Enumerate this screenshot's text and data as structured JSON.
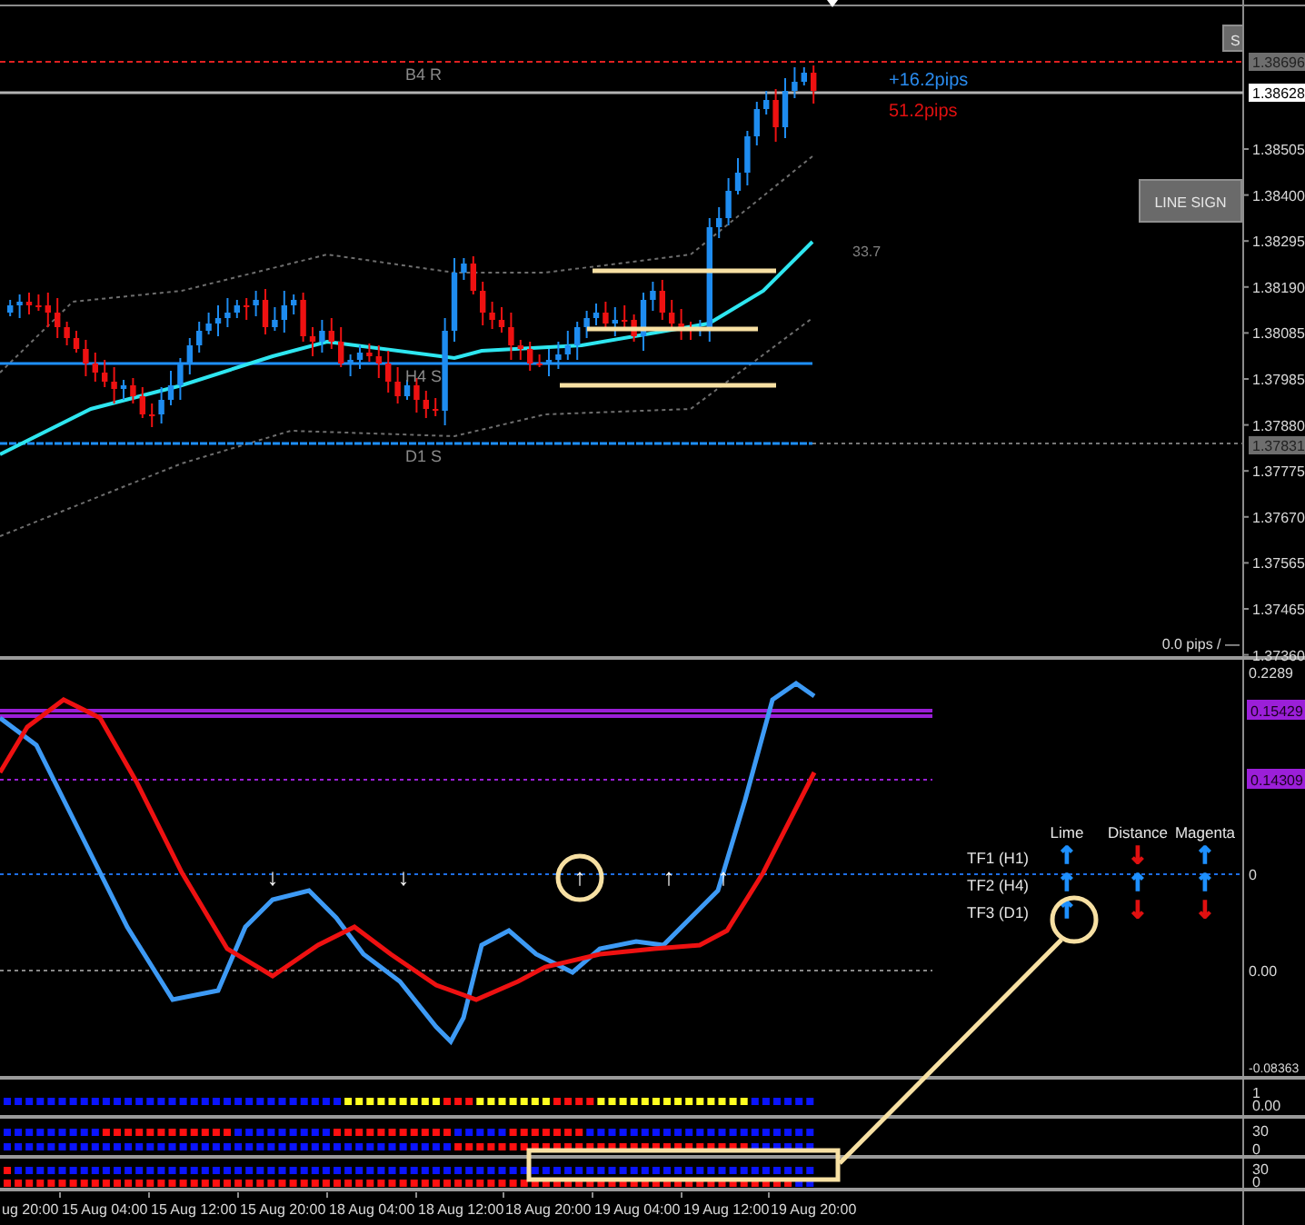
{
  "price_chart": {
    "partial_button": "S",
    "level_labels": [
      "B4 R",
      "H4 S",
      "D1 S"
    ],
    "pips_gain": "+16.2pips",
    "pips_range": "51.2pips",
    "value_label": "33.7",
    "line_sign_button": "LINE SIGN",
    "status_text": "0.0 pips / —",
    "price_axis": [
      "1.38505",
      "1.38400",
      "1.38295",
      "1.38190",
      "1.38085",
      "1.37985",
      "1.37880",
      "1.37775",
      "1.37670",
      "1.37565",
      "1.37465",
      "1.37360"
    ],
    "price_tags": [
      {
        "text": "1.38696",
        "kind": "gray"
      },
      {
        "text": "1.38628",
        "kind": "white"
      },
      {
        "text": "1.37831",
        "kind": "gray"
      }
    ]
  },
  "oscillator": {
    "axis_labels": [
      "0.2289",
      "0",
      "0.00",
      "-0.08363"
    ],
    "value_tags": [
      "0.15429",
      "0.14309"
    ],
    "signals": [
      {
        "arrow": "↓"
      },
      {
        "arrow": "↓"
      },
      {
        "arrow": "↑"
      },
      {
        "arrow": "↑"
      },
      {
        "arrow": "↑"
      }
    ],
    "table": {
      "columns": [
        "Lime",
        "Distance",
        "Magenta"
      ],
      "rows": [
        {
          "label": "TF1 (H1)",
          "cells": [
            {
              "arrow": "↑",
              "color": "#1e90ff"
            },
            {
              "arrow": "↓",
              "color": "#e01010"
            },
            {
              "arrow": "↑",
              "color": "#1e90ff"
            }
          ]
        },
        {
          "label": "TF2 (H4)",
          "cells": [
            {
              "arrow": "↑",
              "color": "#1e90ff"
            },
            {
              "arrow": "↑",
              "color": "#1e90ff"
            },
            {
              "arrow": "↑",
              "color": "#1e90ff"
            }
          ]
        },
        {
          "label": "TF3 (D1)",
          "cells": [
            {
              "arrow": "↑",
              "color": "#1e90ff"
            },
            {
              "arrow": "↓",
              "color": "#e01010"
            },
            {
              "arrow": "↓",
              "color": "#e01010"
            }
          ]
        }
      ]
    }
  },
  "strips": [
    {
      "axis_labels": [
        "1",
        "0.00"
      ]
    },
    {
      "axis_labels": [
        "30",
        "0"
      ]
    },
    {
      "axis_labels": [
        "30",
        "0"
      ]
    }
  ],
  "time_axis": [
    "ug 20:00",
    "15 Aug 04:00",
    "15 Aug 12:00",
    "15 Aug 20:00",
    "18 Aug 04:00",
    "18 Aug 12:00",
    "18 Aug 20:00",
    "19 Aug 04:00",
    "19 Aug 12:00",
    "19 Aug 20:00"
  ]
}
